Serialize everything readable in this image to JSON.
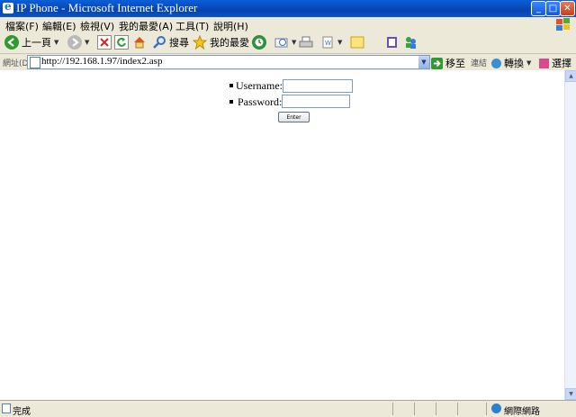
{
  "window": {
    "title": "IP Phone - Microsoft Internet Explorer",
    "buttons": [
      "_",
      "□",
      "✕"
    ]
  },
  "menu": {
    "items": [
      "檔案(F)",
      "編輯(E)",
      "檢視(V)",
      "我的最愛(A)",
      "工具(T)",
      "說明(H)"
    ]
  },
  "toolbar": {
    "back_label": "上一頁",
    "search_label": "搜尋",
    "favorites_label": "我的最愛"
  },
  "address": {
    "label": "網址(D)",
    "url": "http://192.168.1.97/index2.asp",
    "go_label": "移至",
    "links_label": "連結",
    "convert_label": "轉換",
    "select_label": "選擇"
  },
  "form": {
    "username_label": "Username:",
    "password_label": "Password:",
    "username_value": "",
    "password_value": "",
    "submit_label": "Enter"
  },
  "status": {
    "text": "完成",
    "zone": "網際網路"
  }
}
